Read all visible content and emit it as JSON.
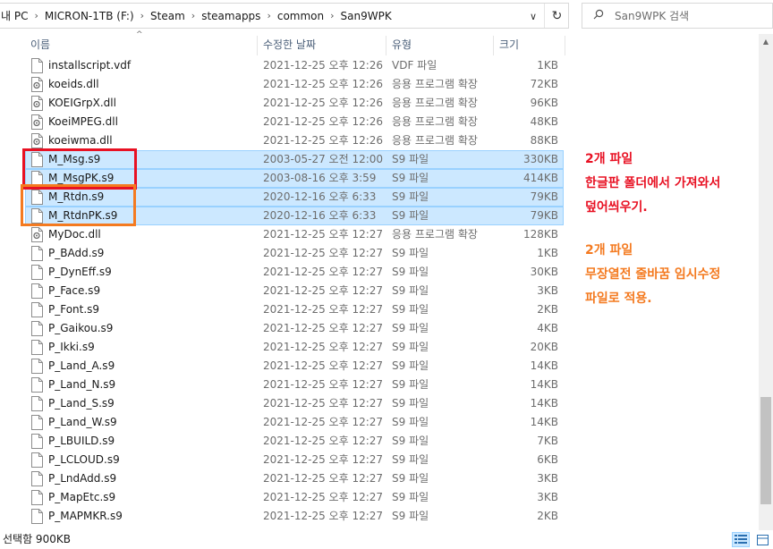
{
  "address_bar": {
    "crumbs": [
      "내 PC",
      "MICRON-1TB (F:)",
      "Steam",
      "steamapps",
      "common",
      "San9WPK"
    ],
    "drop_glyph": "∨",
    "refresh_glyph": "↻"
  },
  "search": {
    "placeholder": "San9WPK 검색"
  },
  "columns": {
    "name": "이름",
    "date": "수정한 날짜",
    "type": "유형",
    "size": "크기"
  },
  "files": [
    {
      "name": "installscript.vdf",
      "date": "2021-12-25 오후 12:26",
      "type": "VDF 파일",
      "size": "1KB",
      "icon": "file-icon",
      "selected": false
    },
    {
      "name": "koeids.dll",
      "date": "2021-12-25 오후 12:26",
      "type": "응용 프로그램 확장",
      "size": "72KB",
      "icon": "dll-icon",
      "selected": false
    },
    {
      "name": "KOEIGrpX.dll",
      "date": "2021-12-25 오후 12:26",
      "type": "응용 프로그램 확장",
      "size": "96KB",
      "icon": "dll-icon",
      "selected": false
    },
    {
      "name": "KoeiMPEG.dll",
      "date": "2021-12-25 오후 12:26",
      "type": "응용 프로그램 확장",
      "size": "48KB",
      "icon": "dll-icon",
      "selected": false
    },
    {
      "name": "koeiwma.dll",
      "date": "2021-12-25 오후 12:26",
      "type": "응용 프로그램 확장",
      "size": "88KB",
      "icon": "dll-icon",
      "selected": false
    },
    {
      "name": "M_Msg.s9",
      "date": "2003-05-27 오전 12:00",
      "type": "S9 파일",
      "size": "330KB",
      "icon": "file-icon",
      "selected": true
    },
    {
      "name": "M_MsgPK.s9",
      "date": "2003-08-16 오후 3:59",
      "type": "S9 파일",
      "size": "414KB",
      "icon": "file-icon",
      "selected": true
    },
    {
      "name": "M_Rtdn.s9",
      "date": "2020-12-16 오후 6:33",
      "type": "S9 파일",
      "size": "79KB",
      "icon": "file-icon",
      "selected": true
    },
    {
      "name": "M_RtdnPK.s9",
      "date": "2020-12-16 오후 6:33",
      "type": "S9 파일",
      "size": "79KB",
      "icon": "file-icon",
      "selected": true
    },
    {
      "name": "MyDoc.dll",
      "date": "2021-12-25 오후 12:27",
      "type": "응용 프로그램 확장",
      "size": "128KB",
      "icon": "dll-icon",
      "selected": false
    },
    {
      "name": "P_BAdd.s9",
      "date": "2021-12-25 오후 12:27",
      "type": "S9 파일",
      "size": "1KB",
      "icon": "file-icon",
      "selected": false
    },
    {
      "name": "P_DynEff.s9",
      "date": "2021-12-25 오후 12:27",
      "type": "S9 파일",
      "size": "30KB",
      "icon": "file-icon",
      "selected": false
    },
    {
      "name": "P_Face.s9",
      "date": "2021-12-25 오후 12:27",
      "type": "S9 파일",
      "size": "3KB",
      "icon": "file-icon",
      "selected": false
    },
    {
      "name": "P_Font.s9",
      "date": "2021-12-25 오후 12:27",
      "type": "S9 파일",
      "size": "2KB",
      "icon": "file-icon",
      "selected": false
    },
    {
      "name": "P_Gaikou.s9",
      "date": "2021-12-25 오후 12:27",
      "type": "S9 파일",
      "size": "4KB",
      "icon": "file-icon",
      "selected": false
    },
    {
      "name": "P_Ikki.s9",
      "date": "2021-12-25 오후 12:27",
      "type": "S9 파일",
      "size": "20KB",
      "icon": "file-icon",
      "selected": false
    },
    {
      "name": "P_Land_A.s9",
      "date": "2021-12-25 오후 12:27",
      "type": "S9 파일",
      "size": "14KB",
      "icon": "file-icon",
      "selected": false
    },
    {
      "name": "P_Land_N.s9",
      "date": "2021-12-25 오후 12:27",
      "type": "S9 파일",
      "size": "14KB",
      "icon": "file-icon",
      "selected": false
    },
    {
      "name": "P_Land_S.s9",
      "date": "2021-12-25 오후 12:27",
      "type": "S9 파일",
      "size": "14KB",
      "icon": "file-icon",
      "selected": false
    },
    {
      "name": "P_Land_W.s9",
      "date": "2021-12-25 오후 12:27",
      "type": "S9 파일",
      "size": "14KB",
      "icon": "file-icon",
      "selected": false
    },
    {
      "name": "P_LBUILD.s9",
      "date": "2021-12-25 오후 12:27",
      "type": "S9 파일",
      "size": "7KB",
      "icon": "file-icon",
      "selected": false
    },
    {
      "name": "P_LCLOUD.s9",
      "date": "2021-12-25 오후 12:27",
      "type": "S9 파일",
      "size": "6KB",
      "icon": "file-icon",
      "selected": false
    },
    {
      "name": "P_LndAdd.s9",
      "date": "2021-12-25 오후 12:27",
      "type": "S9 파일",
      "size": "3KB",
      "icon": "file-icon",
      "selected": false
    },
    {
      "name": "P_MapEtc.s9",
      "date": "2021-12-25 오후 12:27",
      "type": "S9 파일",
      "size": "3KB",
      "icon": "file-icon",
      "selected": false
    },
    {
      "name": "P_MAPMKR.s9",
      "date": "2021-12-25 오후 12:27",
      "type": "S9 파일",
      "size": "2KB",
      "icon": "file-icon",
      "selected": false
    }
  ],
  "annotations": {
    "red": [
      "2개 파일",
      "한글판 폴더에서 가져와서",
      "덮어씌우기."
    ],
    "orange": [
      "2개 파일",
      "무장열전 줄바꿈 임시수정",
      "파일로 적용."
    ]
  },
  "status": {
    "text": "선택함 900KB"
  },
  "colors": {
    "red_highlight": "#e81123",
    "orange_highlight": "#f47a20",
    "selection": "#cce8ff"
  }
}
